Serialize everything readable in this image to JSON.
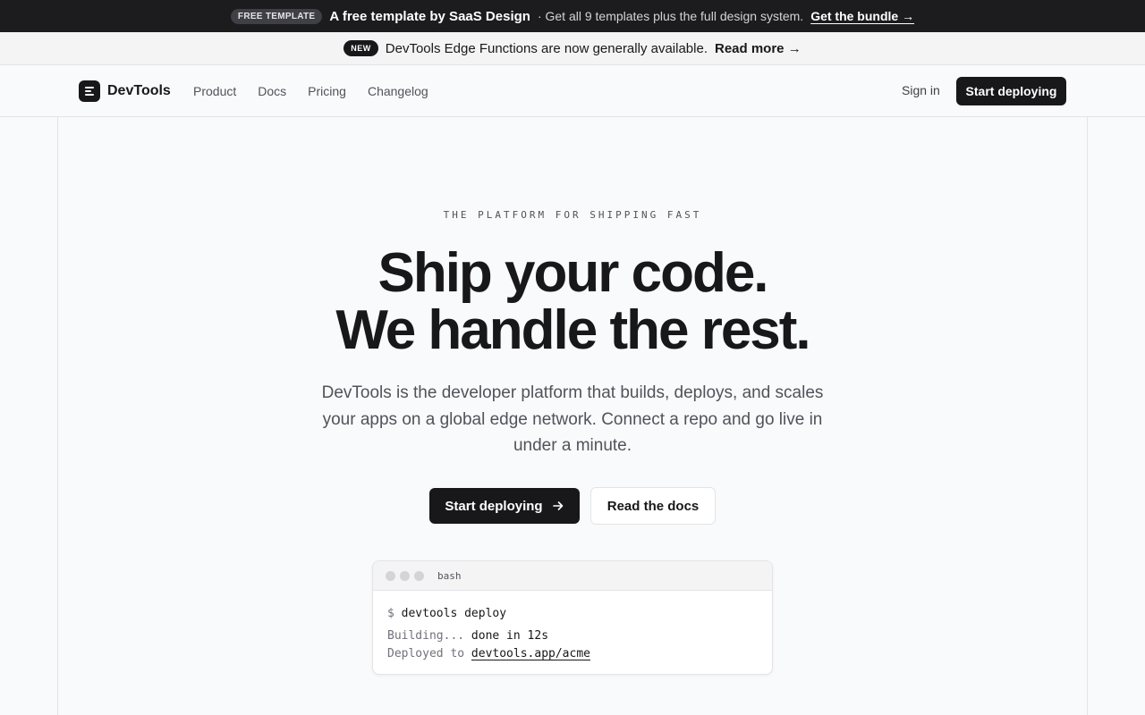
{
  "promo": {
    "badge": "FREE TEMPLATE",
    "title": "A free template by SaaS Design",
    "text": "· Get all 9 templates plus the full design system.",
    "link": "Get the bundle →"
  },
  "announcement": {
    "badge": "NEW",
    "text": "DevTools Edge Functions are now generally available.",
    "link": "Read more →"
  },
  "nav": {
    "logo_text": "DevTools",
    "links": [
      "Product",
      "Docs",
      "Pricing",
      "Changelog"
    ],
    "signin": "Sign in",
    "cta": "Start deploying"
  },
  "hero": {
    "eyebrow": "THE PLATFORM FOR SHIPPING FAST",
    "headline_line1": "Ship your code.",
    "headline_line2": "We handle the rest.",
    "subhead": "DevTools is the developer platform that builds, deploys, and scales your apps on a global edge network. Connect a repo and go live in under a minute.",
    "primary_button": "Start deploying",
    "secondary_button": "Read the docs"
  },
  "terminal": {
    "title": "bash",
    "prompt": "$",
    "command": "devtools deploy",
    "line2_label": "Building...",
    "line2_value": "done in 12s",
    "line3_label": "Deployed to",
    "line3_value": "devtools.app/acme"
  },
  "colors": {
    "dark": "#18181b",
    "background": "#f9fafb",
    "border": "#e4e4e7",
    "muted_text": "#52525b"
  }
}
